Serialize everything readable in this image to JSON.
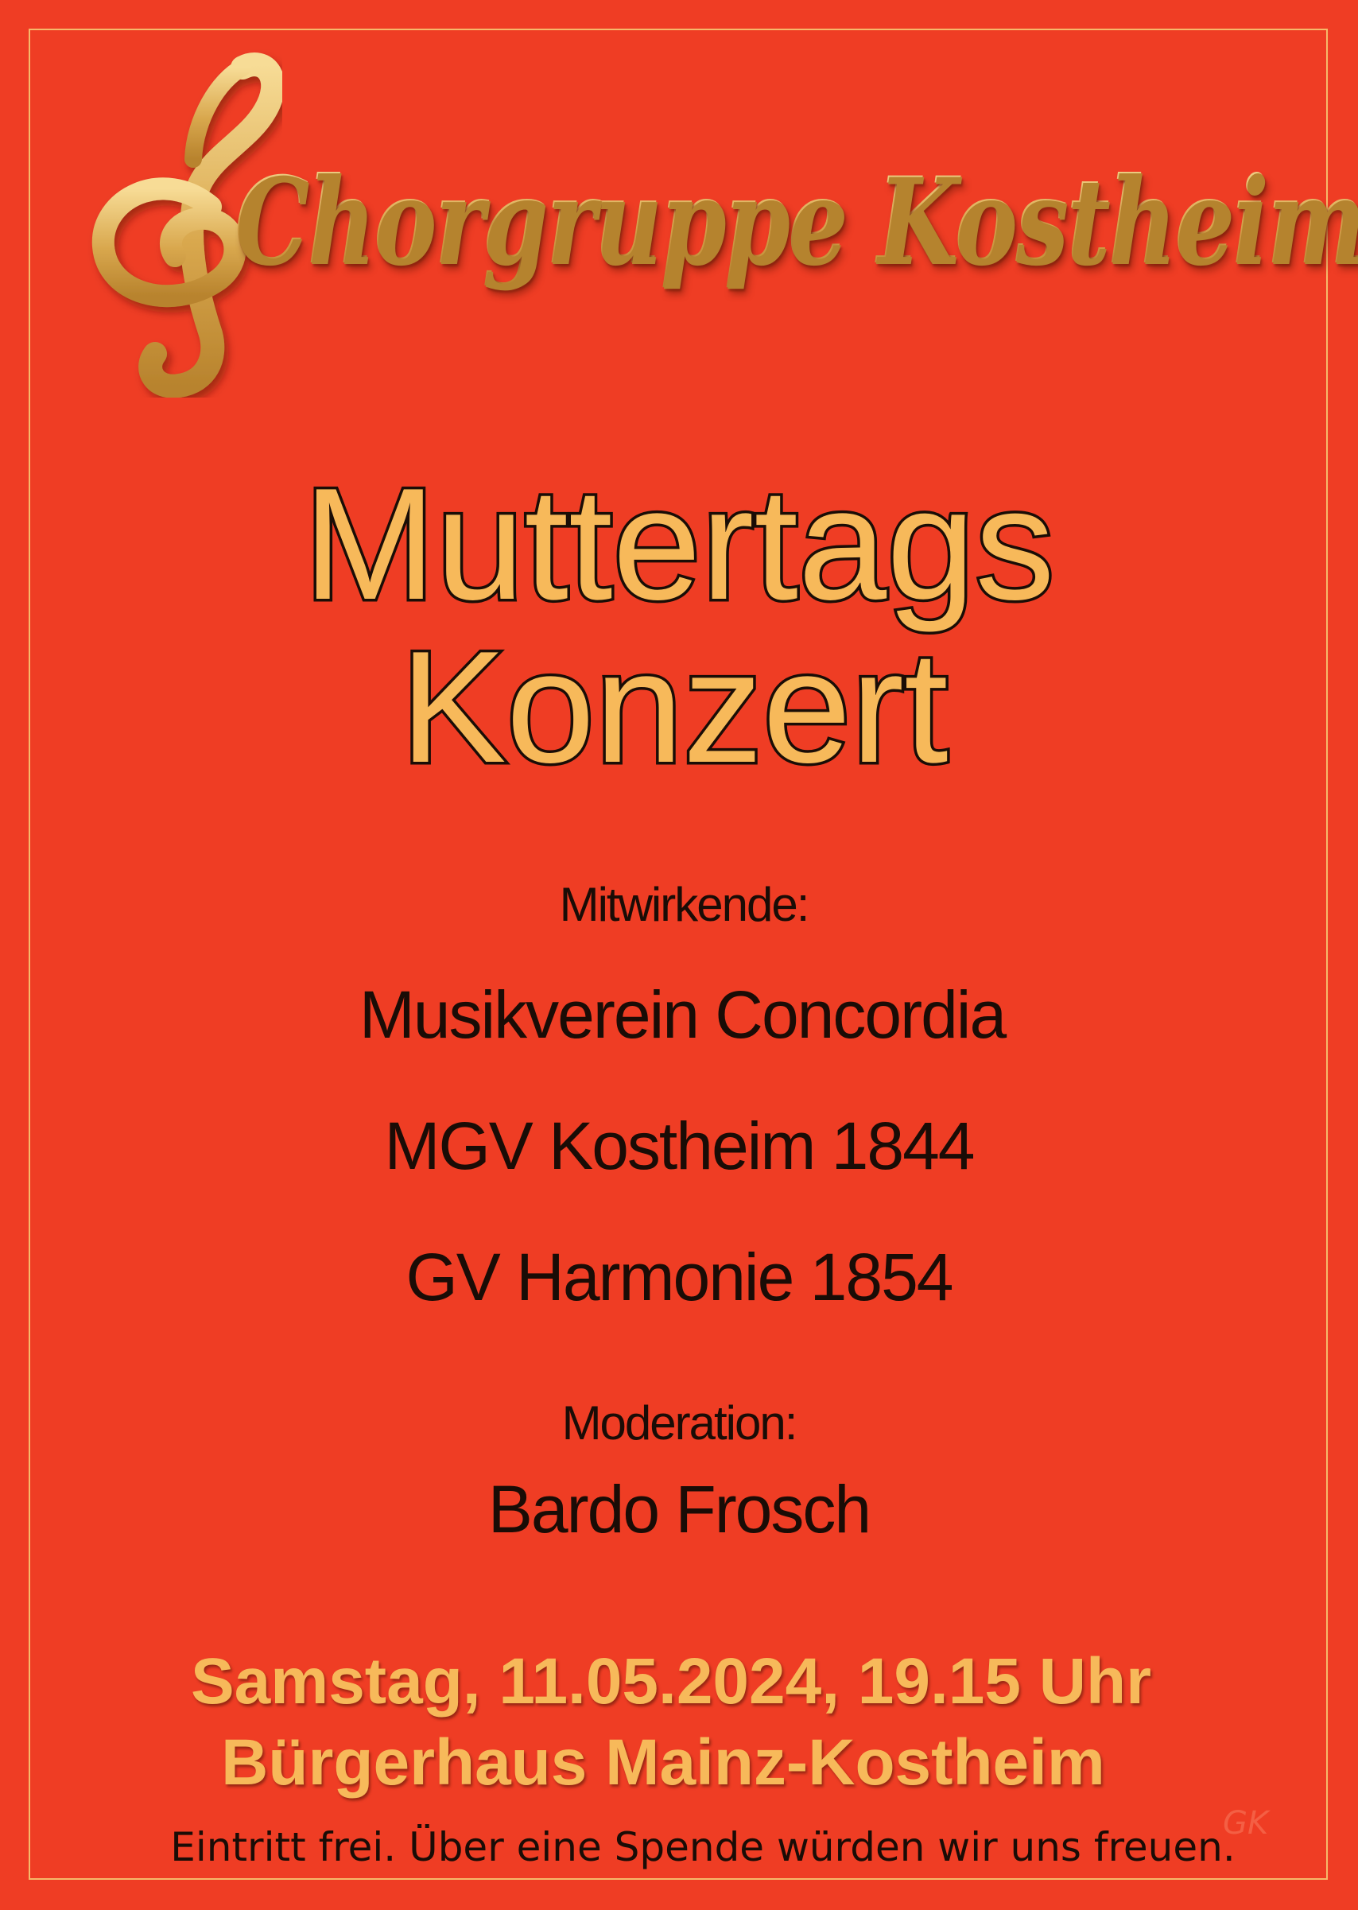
{
  "logo": {
    "text": "Chorgruppe Kostheim",
    "icon": "treble-clef-icon",
    "color": "#e2b75f"
  },
  "title": {
    "line1": "Muttertags",
    "line2": "Konzert",
    "color": "#f7b95a"
  },
  "participants": {
    "label": "Mitwirkende:",
    "items": [
      "Musikverein Concordia",
      "MGV Kostheim 1844",
      "GV Harmonie 1854"
    ]
  },
  "moderation": {
    "label": "Moderation:",
    "name": "Bardo Frosch"
  },
  "event": {
    "datetime": "Samstag, 11.05.2024, 19.15 Uhr",
    "venue": "Bürgerhaus Mainz-Kostheim"
  },
  "note": "Eintritt frei. Über eine Spende würden wir uns freuen.",
  "watermark": "GK",
  "colors": {
    "background": "#ef3d24",
    "accent": "#f7b95a",
    "text": "#1a0c06"
  }
}
